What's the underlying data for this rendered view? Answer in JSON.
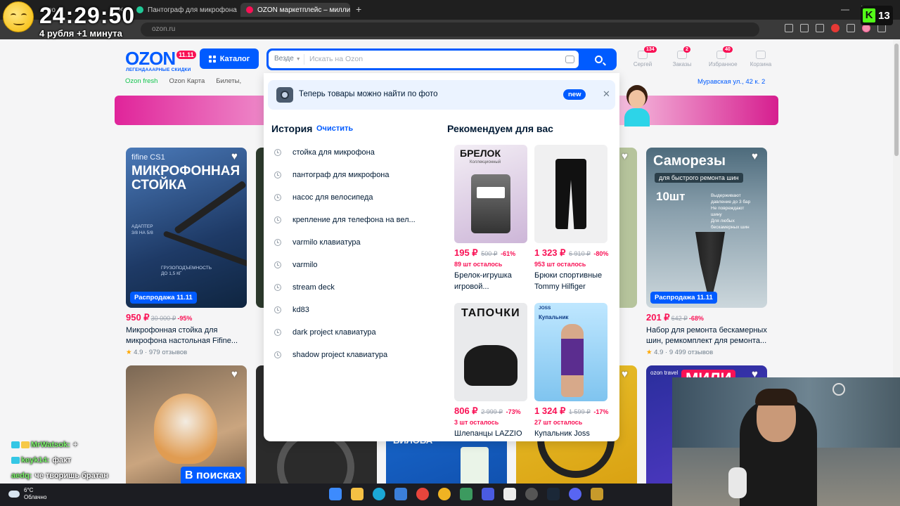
{
  "browser": {
    "tabs": [
      {
        "title": "по",
        "active": false
      },
      {
        "title": "Пантограф для микрофона zo",
        "active": false
      },
      {
        "title": "OZON маркетплейс – миллио",
        "active": true
      }
    ],
    "new_tab": "+",
    "window_controls": [
      "—",
      "☐",
      "✕"
    ],
    "url": "ozon.ru"
  },
  "stream": {
    "timer": "24:29:50",
    "timer_sub": "4 рубля +1 минута",
    "viewer_count": "13",
    "platform_letter": "K"
  },
  "header": {
    "logo": "OZON",
    "logo_badge": "11.11",
    "logo_sub": "ЛЕГЕНДАААРНЫЕ СКИДКИ",
    "catalog_label": "Каталог",
    "icons": [
      {
        "label": "Сергей",
        "count": "134"
      },
      {
        "label": "Заказы",
        "count": "2"
      },
      {
        "label": "Избранное",
        "count": "40"
      },
      {
        "label": "Корзина",
        "count": ""
      }
    ],
    "subnav": [
      "Ozon fresh",
      "Ozon Карта",
      "Билеты,"
    ],
    "address": "Муравская ул., 42 к. 2"
  },
  "search": {
    "scope": "Везде",
    "placeholder": "Искать на Ozon"
  },
  "dropdown": {
    "photo_banner": {
      "text": "Теперь товары можно найти по фото",
      "badge": "new",
      "close": "✕"
    },
    "history_title": "История",
    "history_clear": "Очистить",
    "history": [
      "стойка для микрофона",
      "пантограф для микрофона",
      "насос для велосипеда",
      "крепление для телефона на вел...",
      "varmilo клавиатура",
      "varmilo",
      "stream deck",
      "kd83",
      "dark project клавиатура",
      "shadow project клавиатура"
    ],
    "recommended_title": "Рекомендуем для вас",
    "recommended": [
      {
        "price": "195 ₽",
        "old": "500 ₽",
        "disc": "-61%",
        "left": "89 шт осталось",
        "name1": "Брелок-игрушка",
        "name2": "игровой...",
        "img_label": "БРЕЛОК"
      },
      {
        "price": "1 323 ₽",
        "old": "6 910 ₽",
        "disc": "-80%",
        "left": "953 шт осталось",
        "name1": "Брюки спортивные",
        "name2": "Tommy Hilfiger",
        "img_label": ""
      },
      {
        "price": "806 ₽",
        "old": "2 999 ₽",
        "disc": "-73%",
        "left": "3 шт осталось",
        "name1": "Шлепанцы LAZZIO",
        "name2": "",
        "img_label": "ТАПОЧКИ"
      },
      {
        "price": "1 324 ₽",
        "old": "1 599 ₽",
        "disc": "-17%",
        "left": "27 шт осталось",
        "name1": "Купальник Joss",
        "name2": "",
        "img_label": "Купальник"
      }
    ]
  },
  "products": {
    "mic": {
      "brand": "fifine CS1",
      "img_title": "МИКРОФОННАЯ СТОЙКА",
      "promo": "Распродажа 11.11",
      "price": "950 ₽",
      "old": "30 000 ₽",
      "disc": "-95%",
      "title": "Микрофонная стойка для микрофона настольная Fifine...",
      "rating": "4.9",
      "reviews": "979 отзывов"
    },
    "screws": {
      "img_title": "Саморезы",
      "img_sub": "для быстрого ремонта шин",
      "img_count": "10шт",
      "promo": "Распродажа 11.11",
      "price": "201 ₽",
      "old": "642 ₽",
      "disc": "-68%",
      "title": "Набор для ремонта бескамерных шин, ремкомплект для ремонта...",
      "rating": "4.9",
      "reviews": "9 499 отзывов"
    },
    "cat_label": "В поисках",
    "vitamins_label": "БИЛОБА",
    "travel_tag": "ozon travel",
    "travel_big": "МИЛИ"
  },
  "chat": [
    {
      "user": "MrWatsok:",
      "text": "+"
    },
    {
      "user": "keyk14:",
      "text": "факт"
    },
    {
      "user": "aedq:",
      "text": "че творишь братан"
    }
  ],
  "taskbar": {
    "temp": "6°C",
    "weather": "Облачно"
  }
}
